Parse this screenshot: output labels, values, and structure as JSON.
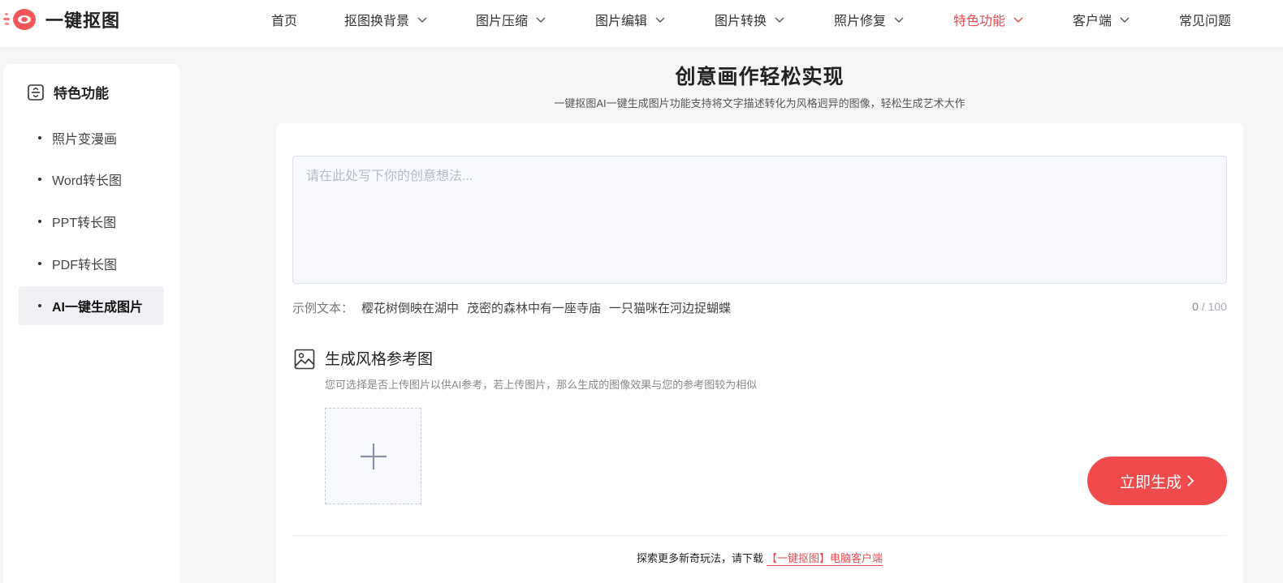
{
  "app": {
    "logo_text": "一键抠图"
  },
  "nav": {
    "items": [
      {
        "label": "首页",
        "dropdown": false
      },
      {
        "label": "抠图换背景",
        "dropdown": true
      },
      {
        "label": "图片压缩",
        "dropdown": true
      },
      {
        "label": "图片编辑",
        "dropdown": true
      },
      {
        "label": "图片转换",
        "dropdown": true
      },
      {
        "label": "照片修复",
        "dropdown": true
      },
      {
        "label": "特色功能",
        "dropdown": true,
        "active": true
      },
      {
        "label": "客户端",
        "dropdown": true
      },
      {
        "label": "常见问题",
        "dropdown": false
      }
    ]
  },
  "sidebar": {
    "heading": "特色功能",
    "items": [
      {
        "label": "照片变漫画"
      },
      {
        "label": "Word转长图"
      },
      {
        "label": "PPT转长图"
      },
      {
        "label": "PDF转长图"
      },
      {
        "label": "AI一键生成图片",
        "active": true
      }
    ]
  },
  "main": {
    "title": "创意画作轻松实现",
    "subtitle": "一键抠图AI一键生成图片功能支持将文字描述转化为风格迥异的图像，轻松生成艺术大作",
    "prompt": {
      "placeholder": "请在此处写下你的创意想法...",
      "value": ""
    },
    "examples": {
      "label": "示例文本：",
      "items": [
        "樱花树倒映在湖中",
        "茂密的森林中有一座寺庙",
        "一只猫咪在河边捉蝴蝶"
      ]
    },
    "counter": {
      "current": "0",
      "max": "/ 100"
    },
    "reference": {
      "title": "生成风格参考图",
      "description": "您可选择是否上传图片以供AI参考，若上传图片，那么生成的图像效果与您的参考图较为相似"
    },
    "generate_button": "立即生成",
    "footer": {
      "text": "探索更多新奇玩法，请下载",
      "link": "【一键抠图】电脑客户端"
    }
  },
  "colors": {
    "accent": "#ef4b4c",
    "active_nav": "#e84a4f"
  }
}
